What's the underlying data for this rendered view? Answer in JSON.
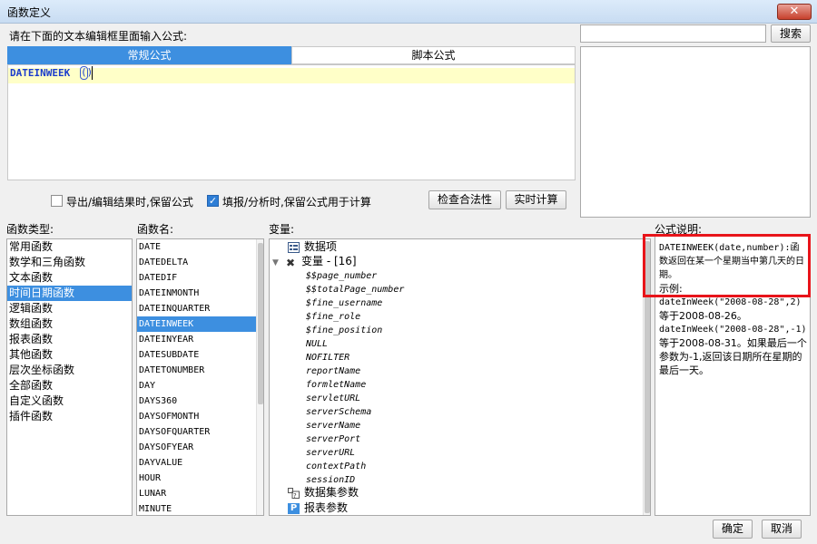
{
  "window": {
    "title": "函数定义",
    "close": "✕"
  },
  "prompt": "请在下面的文本编辑框里面输入公式:",
  "tabs": {
    "normal": "常规公式",
    "script": "脚本公式"
  },
  "editor": {
    "func": "DATEINWEEK",
    "paren": "()"
  },
  "search": {
    "value": "",
    "button": "搜索"
  },
  "options": {
    "export_keep": {
      "label": "导出/编辑结果时,保留公式",
      "checked": false
    },
    "fill_keep": {
      "label": "填报/分析时,保留公式用于计算",
      "checked": true
    },
    "check_btn": "检查合法性",
    "realtime_btn": "实时计算"
  },
  "headers": {
    "func_type": "函数类型:",
    "func_name": "函数名:",
    "variables": "变量:",
    "desc": "公式说明:"
  },
  "func_types": [
    "常用函数",
    "数学和三角函数",
    "文本函数",
    "时间日期函数",
    "逻辑函数",
    "数组函数",
    "报表函数",
    "其他函数",
    "层次坐标函数",
    "全部函数",
    "自定义函数",
    "插件函数"
  ],
  "func_types_selected": 3,
  "func_names": [
    "DATE",
    "DATEDELTA",
    "DATEDIF",
    "DATEINMONTH",
    "DATEINQUARTER",
    "DATEINWEEK",
    "DATEINYEAR",
    "DATESUBDATE",
    "DATETONUMBER",
    "DAY",
    "DAYS360",
    "DAYSOFMONTH",
    "DAYSOFQUARTER",
    "DAYSOFYEAR",
    "DAYVALUE",
    "HOUR",
    "LUNAR",
    "MINUTE"
  ],
  "func_names_selected": 5,
  "tree": {
    "data_items": "数据项",
    "variables_label": "变量 - [16]",
    "vars": [
      "$$page_number",
      "$$totalPage_number",
      "$fine_username",
      "$fine_role",
      "$fine_position",
      "NULL",
      "NOFILTER",
      "reportName",
      "formletName",
      "servletURL",
      "serverSchema",
      "serverName",
      "serverPort",
      "serverURL",
      "contextPath",
      "sessionID"
    ],
    "dataset_params": "数据集参数",
    "report_params": "报表参数"
  },
  "desc": {
    "line1": "DATEINWEEK(date,number):函数返回在某一个星期当中第几天的日期。",
    "example_label": "示例:",
    "ex1": "dateInWeek(\"2008-08-28\",2)",
    "ex1_result": "等于2008-08-26。",
    "ex2": "dateInWeek(\"2008-08-28\",-1)",
    "ex2_result": "等于2008-08-31。如果最后一个参数为-1,返回该日期所在星期的最后一天。"
  },
  "footer": {
    "ok": "确定",
    "cancel": "取消"
  },
  "colors": {
    "accent": "#3d8fe0",
    "highlight": "#e8141a",
    "editor_line": "#ffffc8"
  }
}
